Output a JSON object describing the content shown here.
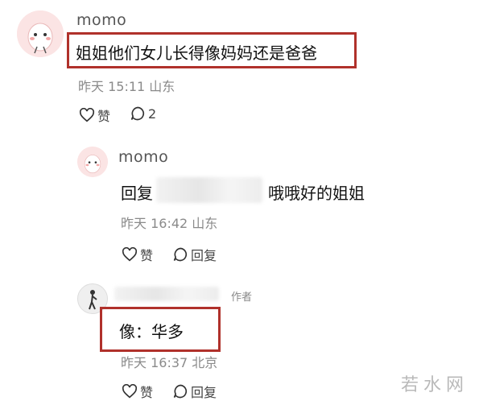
{
  "comments": [
    {
      "username": "momo",
      "text": "姐姐他们女儿长得像妈妈还是爸爸",
      "time": "昨天 15:11",
      "location": "山东",
      "like_label": "赞",
      "reply_count": "2"
    }
  ],
  "replies": [
    {
      "username": "momo",
      "reply_prefix": "回复",
      "text": "哦哦好的姐姐",
      "time": "昨天 16:42",
      "location": "山东",
      "like_label": "赞",
      "reply_label": "回复"
    },
    {
      "author_badge": "作者",
      "text": "像：华多",
      "time": "昨天 16:37",
      "location": "北京",
      "like_label": "赞",
      "reply_label": "回复"
    }
  ],
  "watermark": "若水网",
  "colors": {
    "highlight_box": "#b0312b",
    "avatar_bg": "#fbe4e4"
  }
}
